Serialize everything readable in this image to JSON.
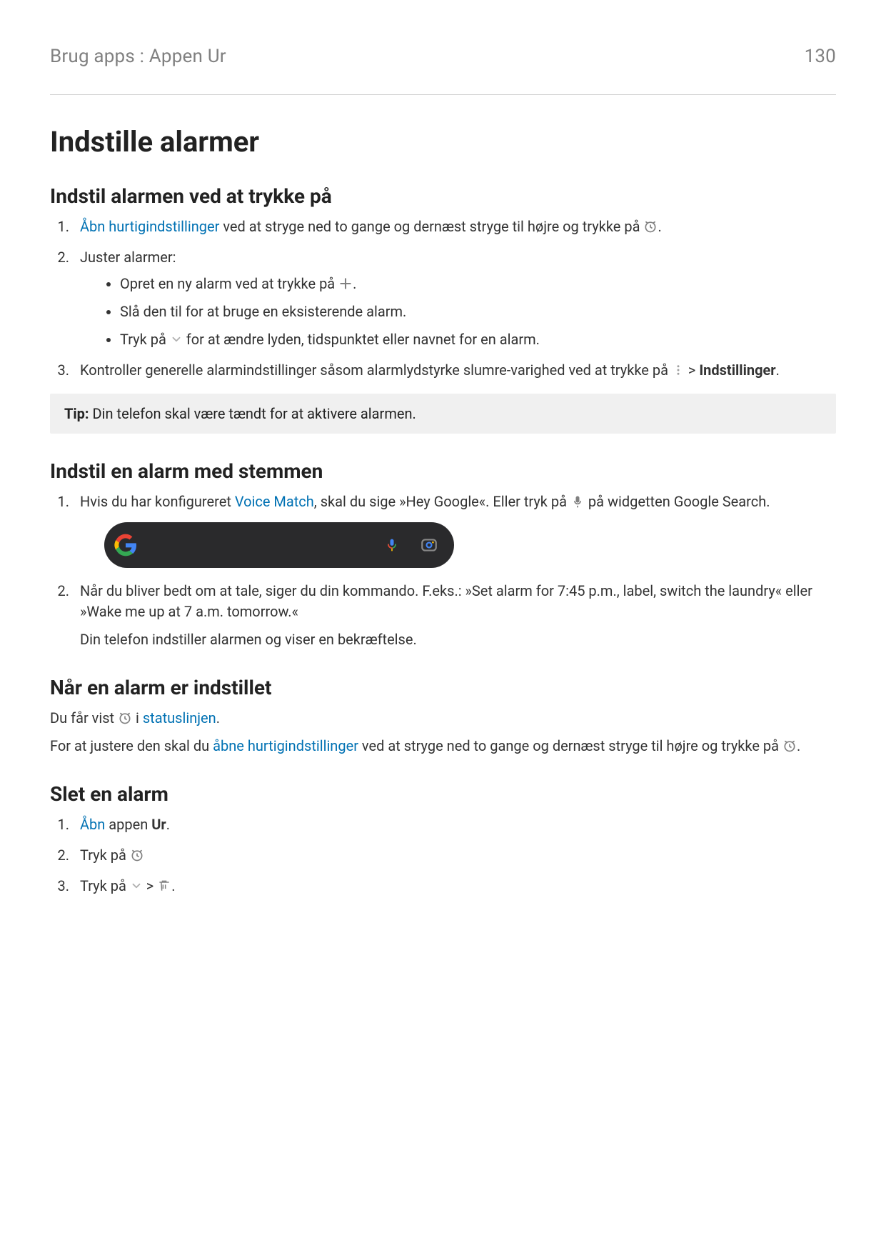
{
  "header": {
    "breadcrumb": "Brug apps : Appen Ur",
    "page_number": "130"
  },
  "h1": "Indstille alarmer",
  "section1": {
    "title": "Indstil alarmen ved at trykke på",
    "step1_link": "Åbn hurtigindstillinger",
    "step1_rest": " ved at stryge ned to gange og dernæst stryge til højre og trykke på ",
    "step1_end": ".",
    "step2_intro": "Juster alarmer:",
    "bullet1_a": "Opret en ny alarm ved at trykke på ",
    "bullet1_b": ".",
    "bullet2": "Slå den til for at bruge en eksisterende alarm.",
    "bullet3_a": "Tryk på ",
    "bullet3_b": " for at ændre lyden, tidspunktet eller navnet for en alarm.",
    "step3_a": "Kontroller generelle alarmindstillinger såsom alarmlydstyrke slumre-varighed ved at trykke på ",
    "step3_b": " > ",
    "step3_bold": "Indstillinger",
    "step3_c": "."
  },
  "tip": {
    "label": "Tip: ",
    "text": "Din telefon skal være tændt for at aktivere alarmen."
  },
  "section2": {
    "title": "Indstil en alarm med stemmen",
    "step1_a": "Hvis du har konfigureret ",
    "step1_link": "Voice Match",
    "step1_b": ", skal du sige »Hey Google«. Eller tryk på ",
    "step1_c": " på widgetten Google Search.",
    "step2_a": "Når du bliver bedt om at tale, siger du din kommando. F.eks.: »Set alarm for 7:45 p.m., label, switch the laundry« eller »Wake me up at 7 a.m. tomorrow.«",
    "step2_p": "Din telefon indstiller alarmen og viser en bekræftelse."
  },
  "section3": {
    "title": "Når en alarm er indstillet",
    "p1_a": "Du får vist ",
    "p1_b": " i ",
    "p1_link": "statuslinjen",
    "p1_c": ".",
    "p2_a": "For at justere den skal du ",
    "p2_link": "åbne hurtigindstillinger",
    "p2_b": " ved at stryge ned to gange og dernæst stryge til højre og trykke på ",
    "p2_c": "."
  },
  "section4": {
    "title": "Slet en alarm",
    "step1_link": "Åbn",
    "step1_a": " appen ",
    "step1_bold": "Ur",
    "step1_b": ".",
    "step2_a": "Tryk på ",
    "step3_a": "Tryk på ",
    "step3_b": " > ",
    "step3_c": "."
  }
}
